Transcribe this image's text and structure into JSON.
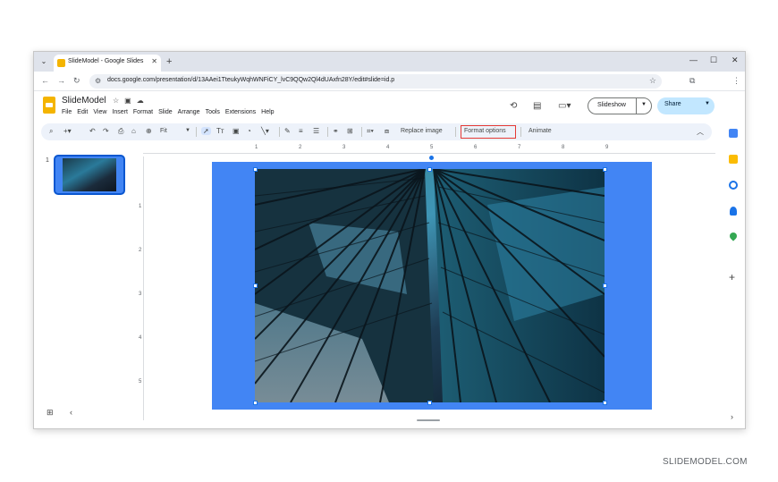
{
  "browser": {
    "tab_title": "SlideModel - Google Slides",
    "tab_close": "✕",
    "new_tab": "+",
    "url": "docs.google.com/presentation/d/13AAei1TteukyWqhWNFiCY_lvC9QQw2Ql4dUAxfn28Y/edit#slide=id.p",
    "window_controls": [
      "—",
      "☐",
      "✕"
    ]
  },
  "app": {
    "doc_title": "SlideModel",
    "menu": [
      "File",
      "Edit",
      "View",
      "Insert",
      "Format",
      "Slide",
      "Arrange",
      "Tools",
      "Extensions",
      "Help"
    ],
    "slideshow_label": "Slideshow",
    "share_label": "Share"
  },
  "toolbar": {
    "zoom_value": "Fit",
    "replace_image": "Replace image",
    "format_options": "Format options",
    "animate": "Animate"
  },
  "filmstrip": {
    "slide_number": "1"
  },
  "ruler": {
    "horizontal": [
      "1",
      "2",
      "3",
      "4",
      "5",
      "6",
      "7",
      "8",
      "9"
    ],
    "vertical": [
      "1",
      "2",
      "3",
      "4",
      "5"
    ]
  },
  "colors": {
    "slide_background": "#4285f4",
    "selection": "#1a73e8",
    "highlight_box": "#e53935",
    "share_button": "#c2e7ff"
  },
  "watermark": "SLIDEMODEL.COM"
}
